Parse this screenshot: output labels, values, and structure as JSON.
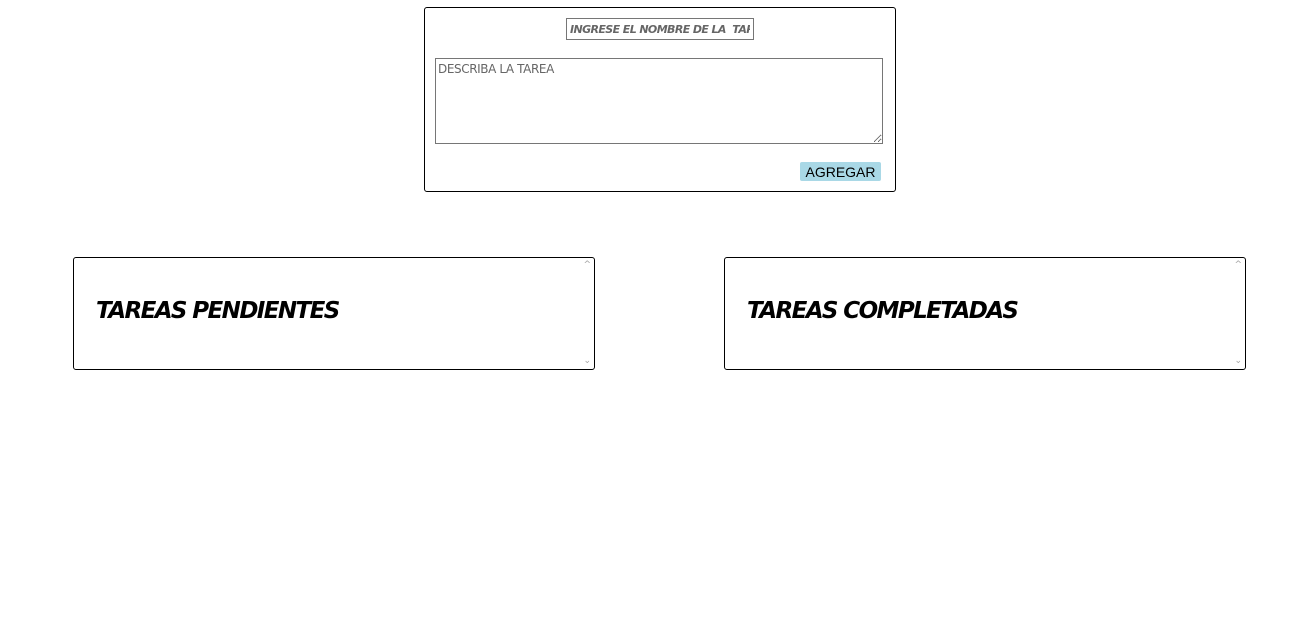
{
  "form": {
    "task_name_placeholder": "INGRESE EL NOMBRE DE LA  TAREA",
    "task_description_placeholder": "DESCRIBA LA TAREA",
    "add_button_label": "AGREGAR"
  },
  "panels": {
    "pending": {
      "title": "TAREAS PENDIENTES"
    },
    "completed": {
      "title": "TAREAS COMPLETADAS"
    }
  },
  "icons": {
    "scroll_up": "chevron-up-icon",
    "scroll_down": "chevron-down-icon"
  },
  "colors": {
    "button_background": "#a9d8e6",
    "border": "#000000",
    "placeholder_text": "#666666"
  }
}
